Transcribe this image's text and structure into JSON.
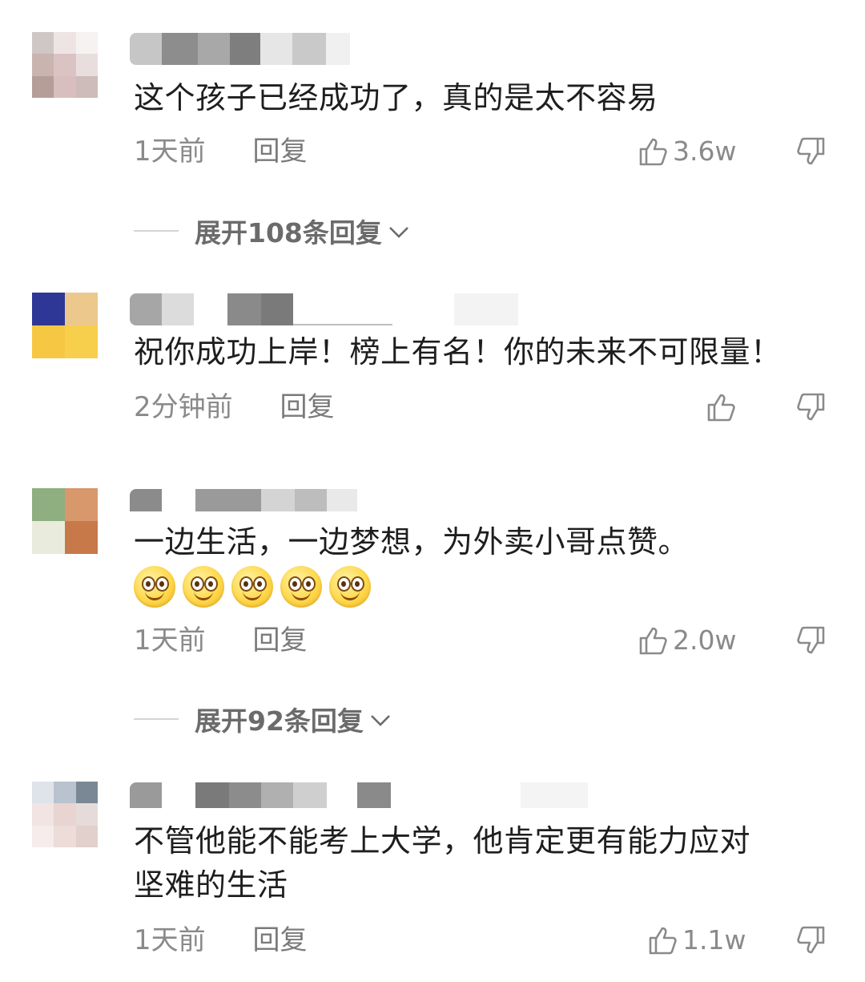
{
  "comments": [
    {
      "text": "这个孩子已经成功了，真的是太不容易",
      "time": "1天前",
      "reply": "回复",
      "likes": "3.6w",
      "expand": "展开108条回复"
    },
    {
      "text": "祝你成功上岸！榜上有名！你的未来不可限量！",
      "time": "2分钟前",
      "reply": "回复",
      "likes": ""
    },
    {
      "text": "一边生活，一边梦想，为外卖小哥点赞。",
      "time": "1天前",
      "reply": "回复",
      "likes": "2.0w",
      "expand": "展开92条回复",
      "emoji": [
        "smiley-emoji",
        "smiley-emoji",
        "smiley-emoji",
        "smiley-emoji",
        "smiley-emoji"
      ]
    },
    {
      "text_line1": "不管他能不能考上大学，他肯定更有能力应对",
      "text_line2": "坚难的生活",
      "time": "1天前",
      "reply": "回复",
      "likes": "1.1w"
    }
  ],
  "icons": {
    "like": "thumbs-up-icon",
    "dislike": "thumbs-down-icon",
    "expand": "chevron-down-icon"
  },
  "colors": {
    "text": "#1e1e1e",
    "meta": "#8a8a8a",
    "expand": "#6b6b6b"
  }
}
